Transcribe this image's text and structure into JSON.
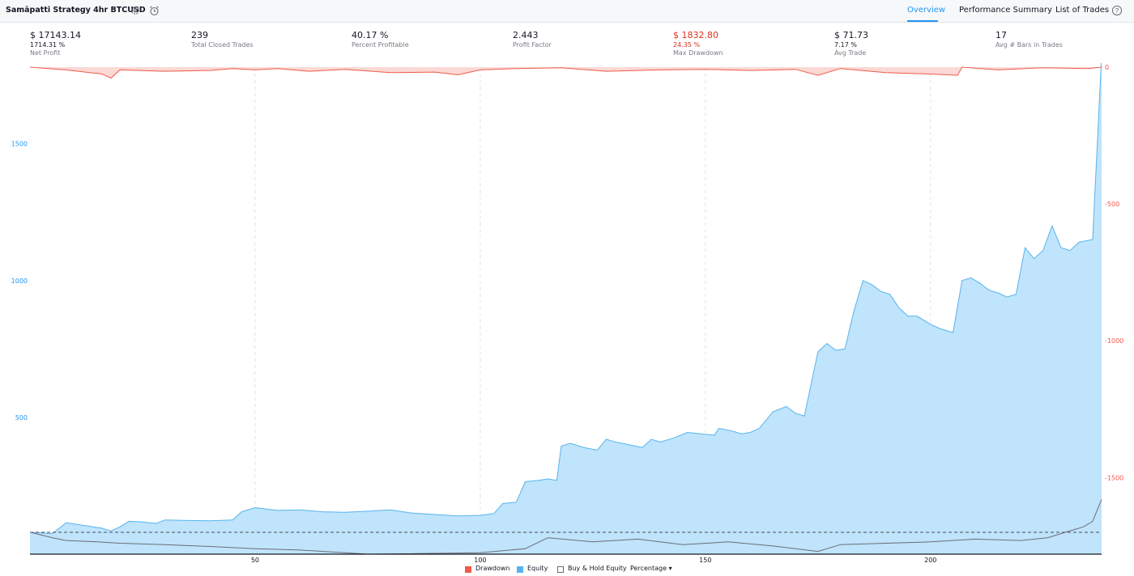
{
  "header": {
    "title": "Samāpatti Strategy 4hr BTCUSD",
    "tabs": [
      "Overview",
      "Performance Summary",
      "List of Trades"
    ],
    "active_tab": "Overview"
  },
  "stats": [
    {
      "value": "$ 17143.14",
      "sub": "1714.31 %",
      "label": "Net Profit",
      "highlight": false
    },
    {
      "value": "239",
      "sub": "",
      "label": "Total Closed Trades",
      "highlight": false
    },
    {
      "value": "40.17 %",
      "sub": "",
      "label": "Percent Profitable",
      "highlight": false
    },
    {
      "value": "2.443",
      "sub": "",
      "label": "Profit Factor",
      "highlight": false
    },
    {
      "value": "$ 1832.80",
      "sub": "24.35 %",
      "label": "Max Drawdown",
      "highlight": true
    },
    {
      "value": "$ 71.73",
      "sub": "7.17 %",
      "label": "Avg Trade",
      "highlight": false
    },
    {
      "value": "17",
      "sub": "",
      "label": "Avg # Bars in Trades",
      "highlight": false
    }
  ],
  "legend": {
    "drawdown": "Drawdown",
    "equity": "Equity",
    "buyhold": "Buy & Hold Equity",
    "mode": "Percentage"
  },
  "colors": {
    "accent": "#2196f3",
    "equity_fill": "#bfe4fb",
    "equity_line": "#56b4ee",
    "drawdown": "#ef5a4a",
    "negative": "#e0301e"
  },
  "chart_data": {
    "type": "area",
    "x_ticks": [
      50,
      100,
      150,
      200
    ],
    "xlim": [
      0,
      238
    ],
    "left_axis": {
      "ticks": [
        500,
        1000,
        1500
      ],
      "ylim": [
        0,
        1780
      ]
    },
    "right_axis": {
      "ticks": [
        0,
        -500,
        -1000,
        -1500
      ],
      "ylim": [
        -1780,
        0
      ]
    },
    "series": [
      {
        "name": "Equity",
        "points": [
          [
            0,
            80
          ],
          [
            5,
            75
          ],
          [
            8,
            115
          ],
          [
            12,
            105
          ],
          [
            16,
            95
          ],
          [
            18,
            85
          ],
          [
            20,
            100
          ],
          [
            22,
            120
          ],
          [
            25,
            118
          ],
          [
            28,
            112
          ],
          [
            30,
            125
          ],
          [
            35,
            123
          ],
          [
            40,
            122
          ],
          [
            45,
            125
          ],
          [
            47,
            155
          ],
          [
            50,
            170
          ],
          [
            55,
            160
          ],
          [
            60,
            162
          ],
          [
            65,
            155
          ],
          [
            70,
            153
          ],
          [
            75,
            157
          ],
          [
            80,
            162
          ],
          [
            85,
            150
          ],
          [
            90,
            145
          ],
          [
            95,
            140
          ],
          [
            100,
            142
          ],
          [
            103,
            148
          ],
          [
            105,
            185
          ],
          [
            108,
            190
          ],
          [
            110,
            265
          ],
          [
            113,
            270
          ],
          [
            115,
            275
          ],
          [
            117,
            270
          ],
          [
            118,
            395
          ],
          [
            120,
            405
          ],
          [
            123,
            390
          ],
          [
            126,
            380
          ],
          [
            128,
            420
          ],
          [
            130,
            410
          ],
          [
            133,
            400
          ],
          [
            136,
            390
          ],
          [
            138,
            420
          ],
          [
            140,
            410
          ],
          [
            143,
            425
          ],
          [
            146,
            445
          ],
          [
            149,
            440
          ],
          [
            152,
            435
          ],
          [
            153,
            460
          ],
          [
            156,
            450
          ],
          [
            158,
            440
          ],
          [
            160,
            445
          ],
          [
            162,
            460
          ],
          [
            165,
            520
          ],
          [
            168,
            540
          ],
          [
            170,
            515
          ],
          [
            172,
            505
          ],
          [
            175,
            740
          ],
          [
            177,
            770
          ],
          [
            179,
            745
          ],
          [
            181,
            750
          ],
          [
            183,
            890
          ],
          [
            185,
            1000
          ],
          [
            187,
            985
          ],
          [
            189,
            960
          ],
          [
            191,
            950
          ],
          [
            193,
            900
          ],
          [
            195,
            870
          ],
          [
            197,
            870
          ],
          [
            200,
            840
          ],
          [
            202,
            825
          ],
          [
            205,
            810
          ],
          [
            207,
            1000
          ],
          [
            209,
            1010
          ],
          [
            211,
            990
          ],
          [
            213,
            965
          ],
          [
            215,
            955
          ],
          [
            217,
            940
          ],
          [
            219,
            950
          ],
          [
            221,
            1120
          ],
          [
            223,
            1080
          ],
          [
            225,
            1110
          ],
          [
            227,
            1200
          ],
          [
            229,
            1120
          ],
          [
            231,
            1110
          ],
          [
            233,
            1140
          ],
          [
            236,
            1150
          ],
          [
            238,
            1820
          ]
        ]
      },
      {
        "name": "Drawdown",
        "points": [
          [
            0,
            0
          ],
          [
            8,
            -10
          ],
          [
            16,
            -25
          ],
          [
            18,
            -40
          ],
          [
            20,
            -10
          ],
          [
            30,
            -15
          ],
          [
            40,
            -12
          ],
          [
            45,
            -5
          ],
          [
            50,
            -10
          ],
          [
            55,
            -5
          ],
          [
            62,
            -15
          ],
          [
            70,
            -8
          ],
          [
            80,
            -20
          ],
          [
            90,
            -18
          ],
          [
            95,
            -28
          ],
          [
            100,
            -10
          ],
          [
            108,
            -5
          ],
          [
            118,
            -2
          ],
          [
            128,
            -15
          ],
          [
            140,
            -10
          ],
          [
            150,
            -8
          ],
          [
            160,
            -12
          ],
          [
            170,
            -8
          ],
          [
            175,
            -30
          ],
          [
            180,
            -5
          ],
          [
            190,
            -20
          ],
          [
            200,
            -25
          ],
          [
            206,
            -30
          ],
          [
            207,
            0
          ],
          [
            215,
            -10
          ],
          [
            225,
            -2
          ],
          [
            235,
            -5
          ],
          [
            238,
            0
          ]
        ]
      },
      {
        "name": "Buy & Hold Equity",
        "points": [
          [
            0,
            80
          ],
          [
            5,
            60
          ],
          [
            8,
            50
          ],
          [
            15,
            45
          ],
          [
            20,
            40
          ],
          [
            30,
            35
          ],
          [
            40,
            28
          ],
          [
            50,
            20
          ],
          [
            60,
            15
          ],
          [
            70,
            5
          ],
          [
            75,
            0
          ],
          [
            100,
            5
          ],
          [
            110,
            20
          ],
          [
            115,
            60
          ],
          [
            125,
            45
          ],
          [
            135,
            55
          ],
          [
            145,
            35
          ],
          [
            155,
            45
          ],
          [
            165,
            30
          ],
          [
            175,
            10
          ],
          [
            180,
            35
          ],
          [
            190,
            40
          ],
          [
            200,
            45
          ],
          [
            210,
            55
          ],
          [
            220,
            50
          ],
          [
            226,
            60
          ],
          [
            230,
            80
          ],
          [
            234,
            100
          ],
          [
            236,
            120
          ],
          [
            238,
            200
          ]
        ]
      }
    ],
    "reference_line": {
      "y": 80,
      "style": "dashed"
    }
  }
}
